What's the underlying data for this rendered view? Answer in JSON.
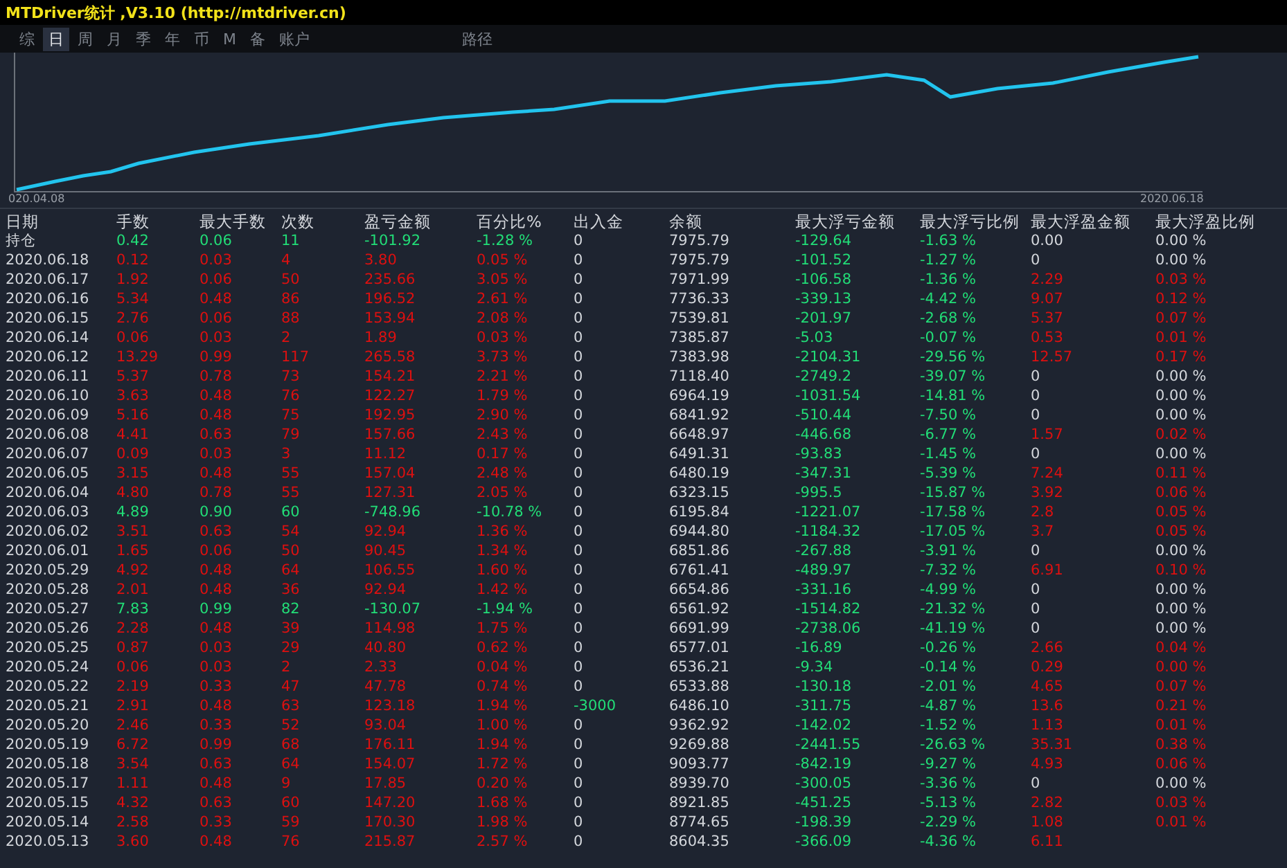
{
  "window": {
    "title": "MTDriver统计 ,V3.10 (http://mtdriver.cn)"
  },
  "tabs": [
    {
      "label": "综",
      "selected": false
    },
    {
      "label": "日",
      "selected": true
    },
    {
      "label": "周",
      "selected": false
    },
    {
      "label": "月",
      "selected": false
    },
    {
      "label": "季",
      "selected": false
    },
    {
      "label": "年",
      "selected": false
    },
    {
      "label": "币",
      "selected": false
    },
    {
      "label": "M",
      "selected": false
    },
    {
      "label": "备",
      "selected": false
    },
    {
      "label": "账户",
      "selected": false
    },
    {
      "label": "路径",
      "selected": false
    }
  ],
  "chart": {
    "start_label": "020.04.08",
    "end_label": "2020.06.18"
  },
  "table": {
    "columns": [
      "日期",
      "手数",
      "最大手数",
      "次数",
      "盈亏金额",
      "百分比%",
      "出入金",
      "余额",
      "最大浮亏金额",
      "最大浮亏比例",
      "最大浮盈金额",
      "最大浮盈比例"
    ],
    "rows": [
      {
        "cells": [
          "持仓",
          "0.42",
          "0.06",
          "11",
          "-101.92",
          "-1.28 %",
          "0",
          "7975.79",
          "-129.64",
          "-1.63 %",
          "0.00",
          "0.00 %"
        ],
        "loss": true,
        "withdrawal": false,
        "float_profit": false
      },
      {
        "cells": [
          "2020.06.18",
          "0.12",
          "0.03",
          "4",
          "3.80",
          "0.05 %",
          "0",
          "7975.79",
          "-101.52",
          "-1.27 %",
          "0",
          "0.00 %"
        ],
        "loss": false,
        "withdrawal": false,
        "float_profit": false
      },
      {
        "cells": [
          "2020.06.17",
          "1.92",
          "0.06",
          "50",
          "235.66",
          "3.05 %",
          "0",
          "7971.99",
          "-106.58",
          "-1.36 %",
          "2.29",
          "0.03 %"
        ],
        "loss": false,
        "withdrawal": false,
        "float_profit": true
      },
      {
        "cells": [
          "2020.06.16",
          "5.34",
          "0.48",
          "86",
          "196.52",
          "2.61 %",
          "0",
          "7736.33",
          "-339.13",
          "-4.42 %",
          "9.07",
          "0.12 %"
        ],
        "loss": false,
        "withdrawal": false,
        "float_profit": true
      },
      {
        "cells": [
          "2020.06.15",
          "2.76",
          "0.06",
          "88",
          "153.94",
          "2.08 %",
          "0",
          "7539.81",
          "-201.97",
          "-2.68 %",
          "5.37",
          "0.07 %"
        ],
        "loss": false,
        "withdrawal": false,
        "float_profit": true
      },
      {
        "cells": [
          "2020.06.14",
          "0.06",
          "0.03",
          "2",
          "1.89",
          "0.03 %",
          "0",
          "7385.87",
          "-5.03",
          "-0.07 %",
          "0.53",
          "0.01 %"
        ],
        "loss": false,
        "withdrawal": false,
        "float_profit": true
      },
      {
        "cells": [
          "2020.06.12",
          "13.29",
          "0.99",
          "117",
          "265.58",
          "3.73 %",
          "0",
          "7383.98",
          "-2104.31",
          "-29.56 %",
          "12.57",
          "0.17 %"
        ],
        "loss": false,
        "withdrawal": false,
        "float_profit": true
      },
      {
        "cells": [
          "2020.06.11",
          "5.37",
          "0.78",
          "73",
          "154.21",
          "2.21 %",
          "0",
          "7118.40",
          "-2749.2",
          "-39.07 %",
          "0",
          "0.00 %"
        ],
        "loss": false,
        "withdrawal": false,
        "float_profit": false
      },
      {
        "cells": [
          "2020.06.10",
          "3.63",
          "0.48",
          "76",
          "122.27",
          "1.79 %",
          "0",
          "6964.19",
          "-1031.54",
          "-14.81 %",
          "0",
          "0.00 %"
        ],
        "loss": false,
        "withdrawal": false,
        "float_profit": false
      },
      {
        "cells": [
          "2020.06.09",
          "5.16",
          "0.48",
          "75",
          "192.95",
          "2.90 %",
          "0",
          "6841.92",
          "-510.44",
          "-7.50 %",
          "0",
          "0.00 %"
        ],
        "loss": false,
        "withdrawal": false,
        "float_profit": false
      },
      {
        "cells": [
          "2020.06.08",
          "4.41",
          "0.63",
          "79",
          "157.66",
          "2.43 %",
          "0",
          "6648.97",
          "-446.68",
          "-6.77 %",
          "1.57",
          "0.02 %"
        ],
        "loss": false,
        "withdrawal": false,
        "float_profit": true
      },
      {
        "cells": [
          "2020.06.07",
          "0.09",
          "0.03",
          "3",
          "11.12",
          "0.17 %",
          "0",
          "6491.31",
          "-93.83",
          "-1.45 %",
          "0",
          "0.00 %"
        ],
        "loss": false,
        "withdrawal": false,
        "float_profit": false
      },
      {
        "cells": [
          "2020.06.05",
          "3.15",
          "0.48",
          "55",
          "157.04",
          "2.48 %",
          "0",
          "6480.19",
          "-347.31",
          "-5.39 %",
          "7.24",
          "0.11 %"
        ],
        "loss": false,
        "withdrawal": false,
        "float_profit": true
      },
      {
        "cells": [
          "2020.06.04",
          "4.80",
          "0.78",
          "55",
          "127.31",
          "2.05 %",
          "0",
          "6323.15",
          "-995.5",
          "-15.87 %",
          "3.92",
          "0.06 %"
        ],
        "loss": false,
        "withdrawal": false,
        "float_profit": true
      },
      {
        "cells": [
          "2020.06.03",
          "4.89",
          "0.90",
          "60",
          "-748.96",
          "-10.78 %",
          "0",
          "6195.84",
          "-1221.07",
          "-17.58 %",
          "2.8",
          "0.05 %"
        ],
        "loss": true,
        "withdrawal": false,
        "float_profit": true
      },
      {
        "cells": [
          "2020.06.02",
          "3.51",
          "0.63",
          "54",
          "92.94",
          "1.36 %",
          "0",
          "6944.80",
          "-1184.32",
          "-17.05 %",
          "3.7",
          "0.05 %"
        ],
        "loss": false,
        "withdrawal": false,
        "float_profit": true
      },
      {
        "cells": [
          "2020.06.01",
          "1.65",
          "0.06",
          "50",
          "90.45",
          "1.34 %",
          "0",
          "6851.86",
          "-267.88",
          "-3.91 %",
          "0",
          "0.00 %"
        ],
        "loss": false,
        "withdrawal": false,
        "float_profit": false
      },
      {
        "cells": [
          "2020.05.29",
          "4.92",
          "0.48",
          "64",
          "106.55",
          "1.60 %",
          "0",
          "6761.41",
          "-489.97",
          "-7.32 %",
          "6.91",
          "0.10 %"
        ],
        "loss": false,
        "withdrawal": false,
        "float_profit": true
      },
      {
        "cells": [
          "2020.05.28",
          "2.01",
          "0.48",
          "36",
          "92.94",
          "1.42 %",
          "0",
          "6654.86",
          "-331.16",
          "-4.99 %",
          "0",
          "0.00 %"
        ],
        "loss": false,
        "withdrawal": false,
        "float_profit": false
      },
      {
        "cells": [
          "2020.05.27",
          "7.83",
          "0.99",
          "82",
          "-130.07",
          "-1.94 %",
          "0",
          "6561.92",
          "-1514.82",
          "-21.32 %",
          "0",
          "0.00 %"
        ],
        "loss": true,
        "withdrawal": false,
        "float_profit": false
      },
      {
        "cells": [
          "2020.05.26",
          "2.28",
          "0.48",
          "39",
          "114.98",
          "1.75 %",
          "0",
          "6691.99",
          "-2738.06",
          "-41.19 %",
          "0",
          "0.00 %"
        ],
        "loss": false,
        "withdrawal": false,
        "float_profit": false
      },
      {
        "cells": [
          "2020.05.25",
          "0.87",
          "0.03",
          "29",
          "40.80",
          "0.62 %",
          "0",
          "6577.01",
          "-16.89",
          "-0.26 %",
          "2.66",
          "0.04 %"
        ],
        "loss": false,
        "withdrawal": false,
        "float_profit": true
      },
      {
        "cells": [
          "2020.05.24",
          "0.06",
          "0.03",
          "2",
          "2.33",
          "0.04 %",
          "0",
          "6536.21",
          "-9.34",
          "-0.14 %",
          "0.29",
          "0.00 %"
        ],
        "loss": false,
        "withdrawal": false,
        "float_profit": true
      },
      {
        "cells": [
          "2020.05.22",
          "2.19",
          "0.33",
          "47",
          "47.78",
          "0.74 %",
          "0",
          "6533.88",
          "-130.18",
          "-2.01 %",
          "4.65",
          "0.07 %"
        ],
        "loss": false,
        "withdrawal": false,
        "float_profit": true
      },
      {
        "cells": [
          "2020.05.21",
          "2.91",
          "0.48",
          "63",
          "123.18",
          "1.94 %",
          "-3000",
          "6486.10",
          "-311.75",
          "-4.87 %",
          "13.6",
          "0.21 %"
        ],
        "loss": false,
        "withdrawal": true,
        "float_profit": true
      },
      {
        "cells": [
          "2020.05.20",
          "2.46",
          "0.33",
          "52",
          "93.04",
          "1.00 %",
          "0",
          "9362.92",
          "-142.02",
          "-1.52 %",
          "1.13",
          "0.01 %"
        ],
        "loss": false,
        "withdrawal": false,
        "float_profit": true
      },
      {
        "cells": [
          "2020.05.19",
          "6.72",
          "0.99",
          "68",
          "176.11",
          "1.94 %",
          "0",
          "9269.88",
          "-2441.55",
          "-26.63 %",
          "35.31",
          "0.38 %"
        ],
        "loss": false,
        "withdrawal": false,
        "float_profit": true
      },
      {
        "cells": [
          "2020.05.18",
          "3.54",
          "0.63",
          "64",
          "154.07",
          "1.72 %",
          "0",
          "9093.77",
          "-842.19",
          "-9.27 %",
          "4.93",
          "0.06 %"
        ],
        "loss": false,
        "withdrawal": false,
        "float_profit": true
      },
      {
        "cells": [
          "2020.05.17",
          "1.11",
          "0.48",
          "9",
          "17.85",
          "0.20 %",
          "0",
          "8939.70",
          "-300.05",
          "-3.36 %",
          "0",
          "0.00 %"
        ],
        "loss": false,
        "withdrawal": false,
        "float_profit": false
      },
      {
        "cells": [
          "2020.05.15",
          "4.32",
          "0.63",
          "60",
          "147.20",
          "1.68 %",
          "0",
          "8921.85",
          "-451.25",
          "-5.13 %",
          "2.82",
          "0.03 %"
        ],
        "loss": false,
        "withdrawal": false,
        "float_profit": true
      },
      {
        "cells": [
          "2020.05.14",
          "2.58",
          "0.33",
          "59",
          "170.30",
          "1.98 %",
          "0",
          "8774.65",
          "-198.39",
          "-2.29 %",
          "1.08",
          "0.01 %"
        ],
        "loss": false,
        "withdrawal": false,
        "float_profit": true
      },
      {
        "cells": [
          "2020.05.13",
          "3.60",
          "0.48",
          "76",
          "215.87",
          "2.57 %",
          "0",
          "8604.35",
          "-366.09",
          "-4.36 %",
          "6.11"
        ],
        "loss": false,
        "withdrawal": false,
        "float_profit": true
      }
    ]
  }
}
